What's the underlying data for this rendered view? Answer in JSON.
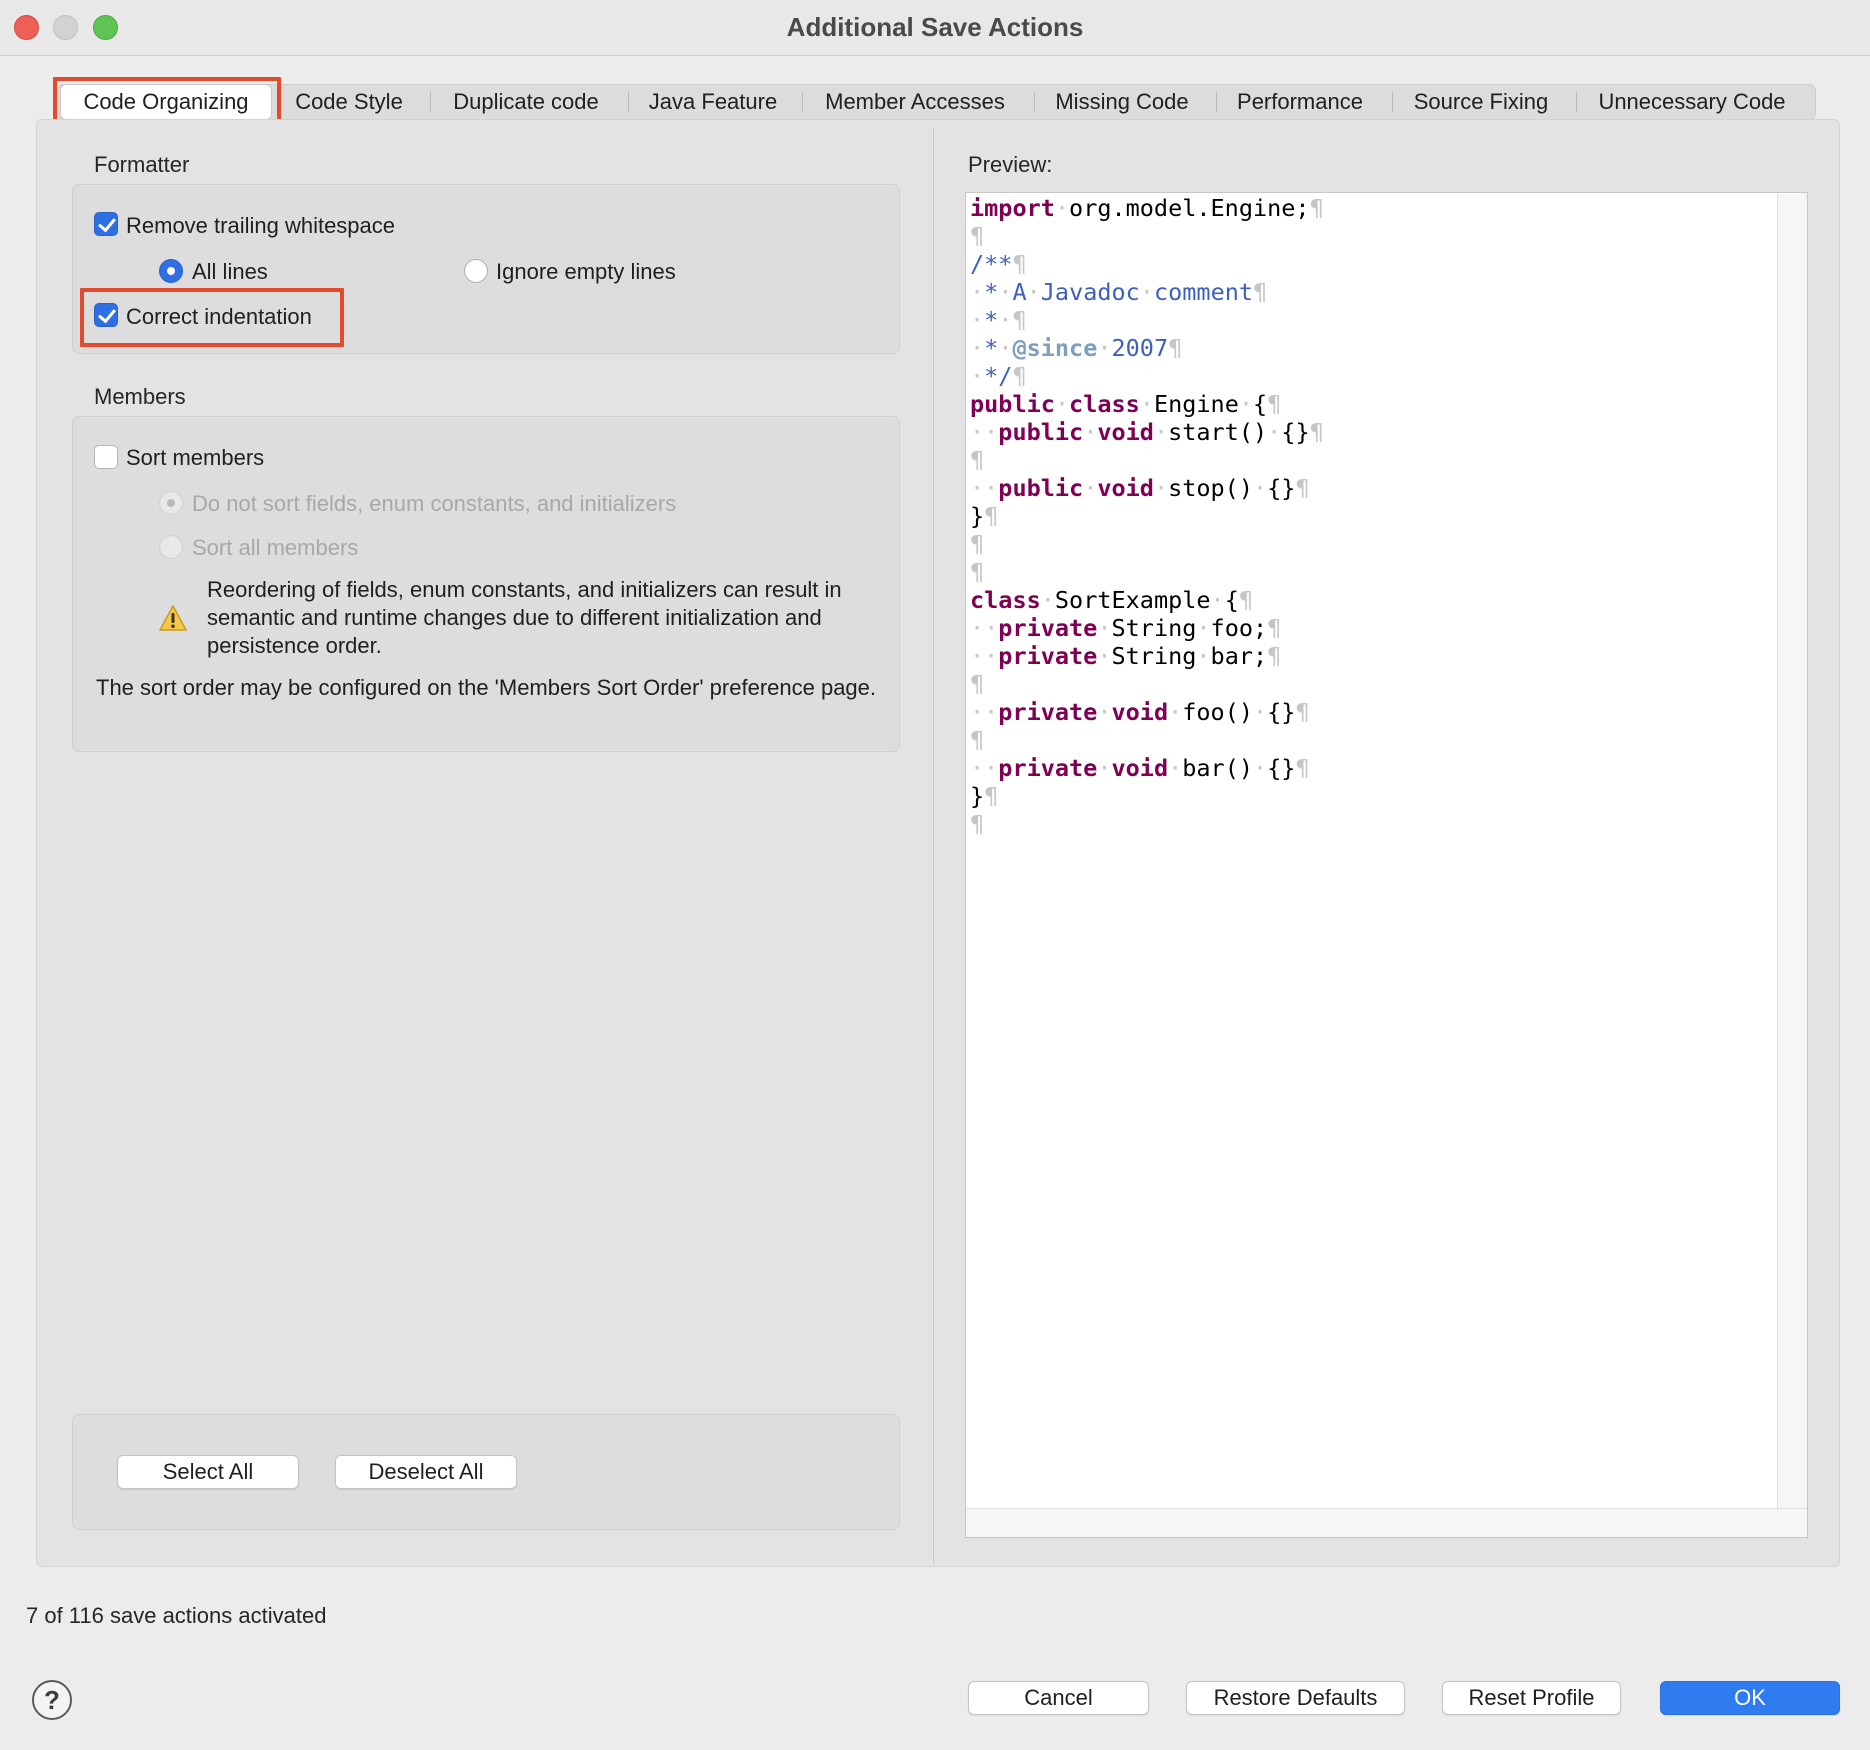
{
  "window": {
    "title": "Additional Save Actions"
  },
  "tabs": [
    {
      "label": "Code Organizing",
      "active": true
    },
    {
      "label": "Code Style"
    },
    {
      "label": "Duplicate code"
    },
    {
      "label": "Java Feature"
    },
    {
      "label": "Member Accesses"
    },
    {
      "label": "Missing Code"
    },
    {
      "label": "Performance"
    },
    {
      "label": "Source Fixing"
    },
    {
      "label": "Unnecessary Code"
    }
  ],
  "formatter": {
    "group_label": "Formatter",
    "remove_trailing_whitespace": {
      "label": "Remove trailing whitespace",
      "checked": true
    },
    "all_lines": {
      "label": "All lines",
      "selected": true
    },
    "ignore_empty_lines": {
      "label": "Ignore empty lines",
      "selected": false
    },
    "correct_indentation": {
      "label": "Correct indentation",
      "checked": true
    }
  },
  "members": {
    "group_label": "Members",
    "sort_members": {
      "label": "Sort members",
      "checked": false
    },
    "do_not_sort": {
      "label": "Do not sort fields, enum constants, and initializers",
      "selected": true,
      "enabled": false
    },
    "sort_all": {
      "label": "Sort all members",
      "selected": false,
      "enabled": false
    },
    "warning_text": "Reordering of fields, enum constants, and initializers can result in semantic and runtime changes due to different initialization and persistence order.",
    "info_text": "The sort order may be configured on the 'Members Sort Order' preference page."
  },
  "selection_buttons": {
    "select_all": "Select All",
    "deselect_all": "Deselect All"
  },
  "preview": {
    "label": "Preview:"
  },
  "status": "7 of 116 save actions activated",
  "footer": {
    "help": "?",
    "cancel": "Cancel",
    "restore_defaults": "Restore Defaults",
    "reset_profile": "Reset Profile",
    "ok": "OK"
  },
  "colors": {
    "accent": "#2f7cf0",
    "highlight_box": "#e34a2e",
    "keyword": "#7f0055",
    "javadoc": "#3f5fbf",
    "javadoc_tag": "#7f9fbf"
  },
  "icons": {
    "warning": "warning-triangle-icon",
    "help": "help-circle-icon"
  }
}
